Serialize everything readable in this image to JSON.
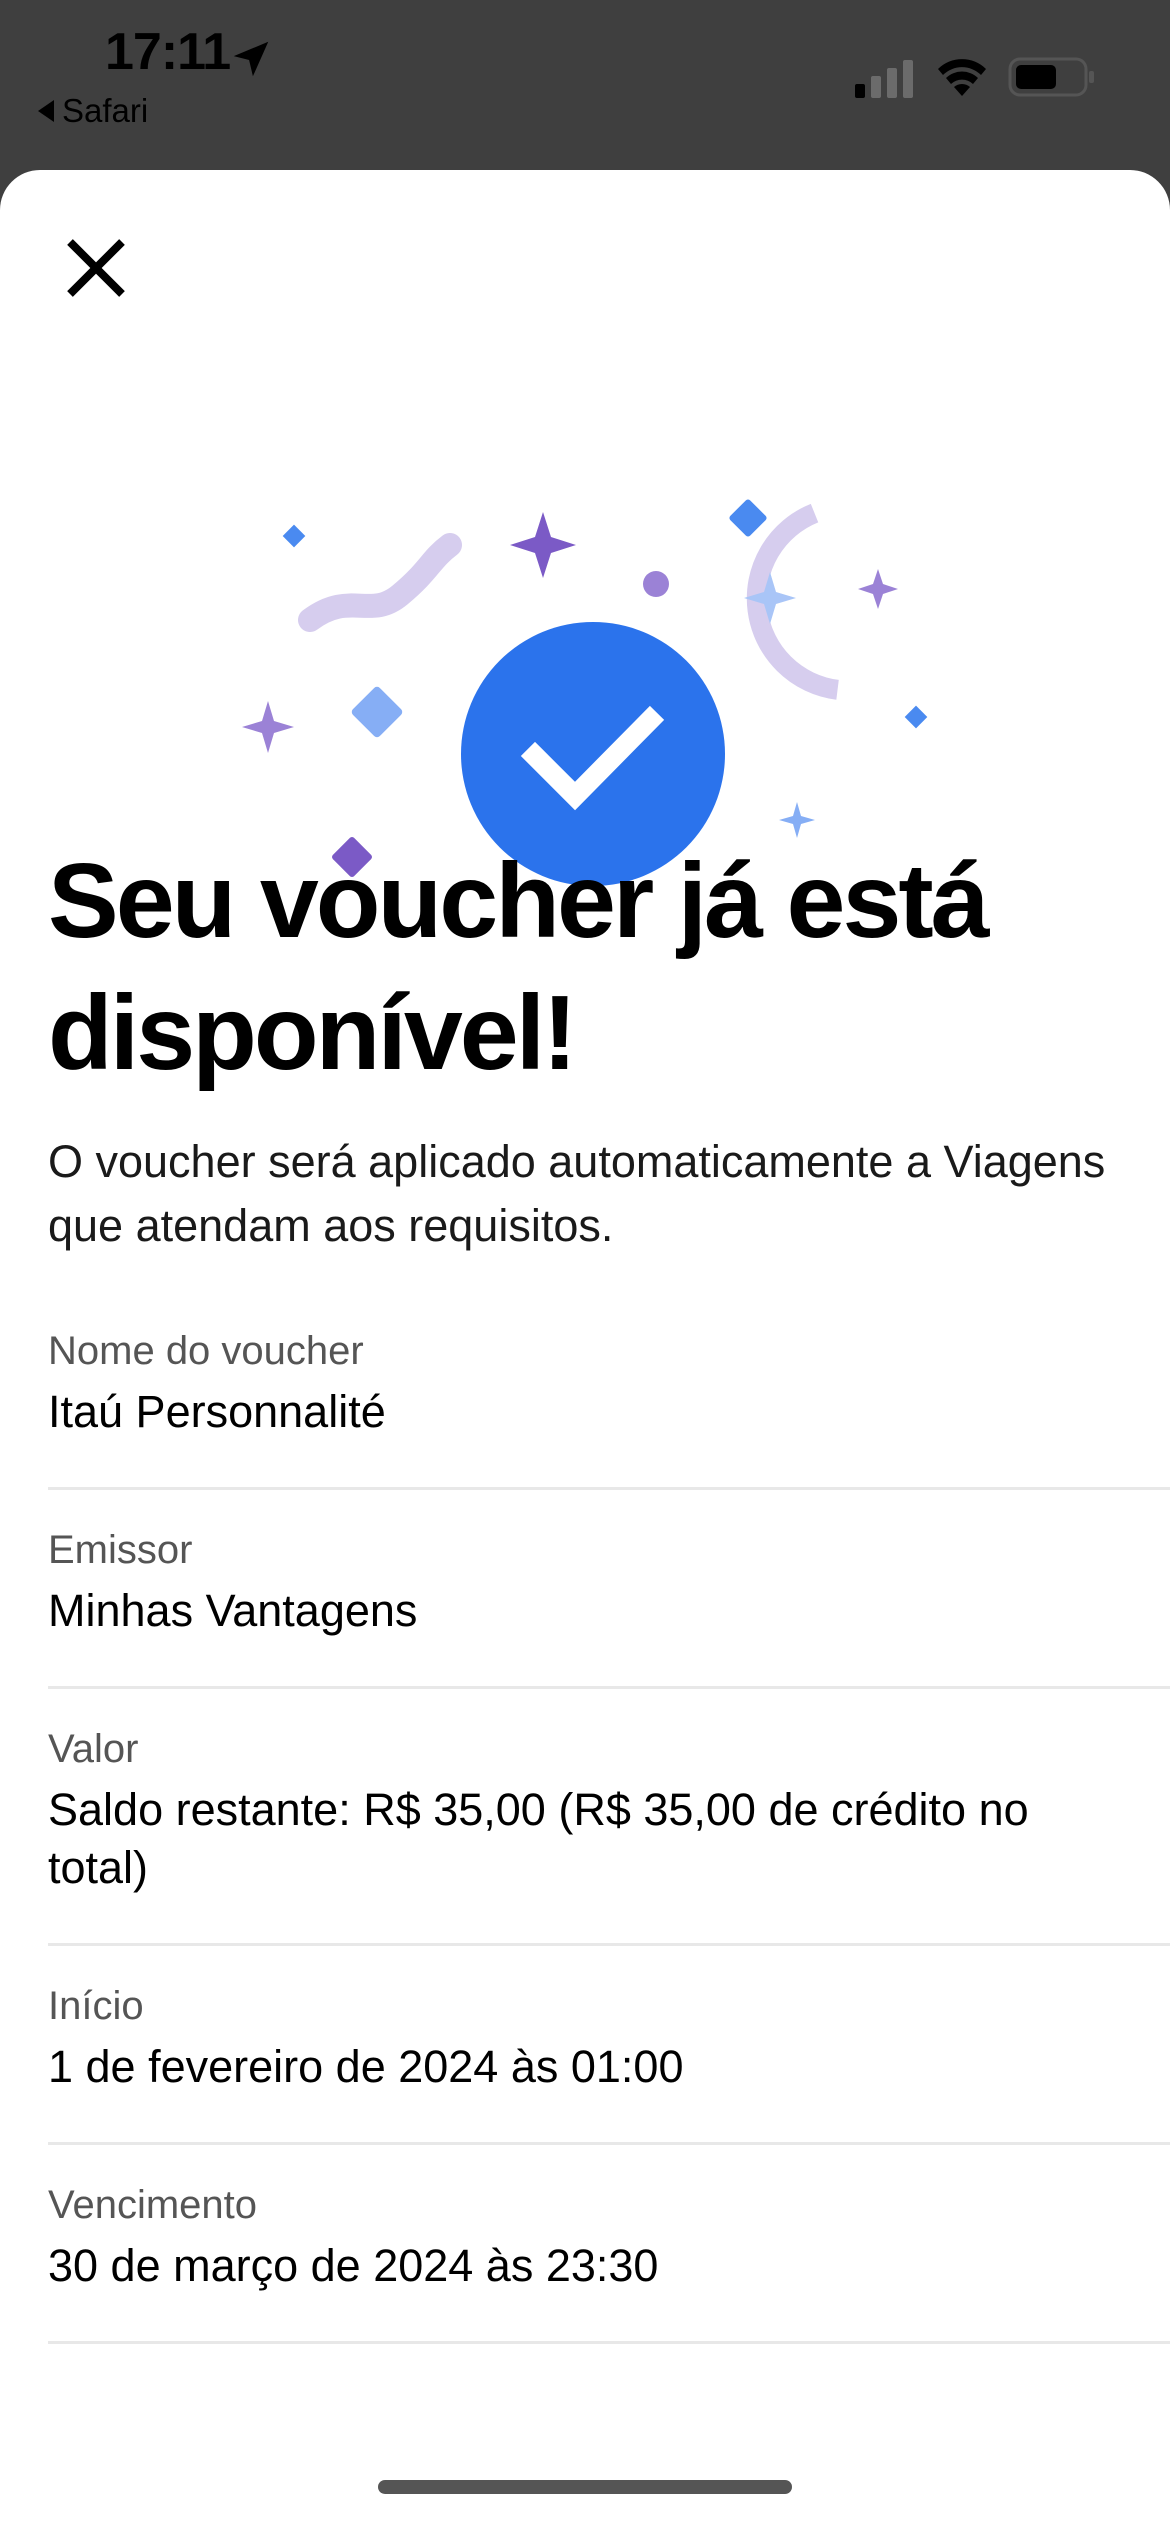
{
  "status_bar": {
    "time": "17:11",
    "back_label": "Safari"
  },
  "header": {
    "title": "Seu voucher já está disponível!",
    "subtitle": "O voucher será aplicado automaticamente a Viagens que atendam aos requisitos."
  },
  "details": [
    {
      "label": "Nome do voucher",
      "value": "Itaú Personnalité"
    },
    {
      "label": "Emissor",
      "value": "Minhas Vantagens"
    },
    {
      "label": "Valor",
      "value": "Saldo restante: R$ 35,00 (R$ 35,00 de crédito no total)"
    },
    {
      "label": "Início",
      "value": "1 de fevereiro de 2024 às 01:00"
    },
    {
      "label": "Vencimento",
      "value": "30 de março de 2024 às 23:30"
    }
  ],
  "icons": {
    "close": "close-icon",
    "success": "checkmark-circle-icon",
    "location": "location-arrow-icon"
  },
  "colors": {
    "accent": "#2b73ec",
    "confetti_purple": "#7b5ac6",
    "confetti_lavender": "#d6cdee",
    "confetti_blue": "#4a8af0"
  }
}
